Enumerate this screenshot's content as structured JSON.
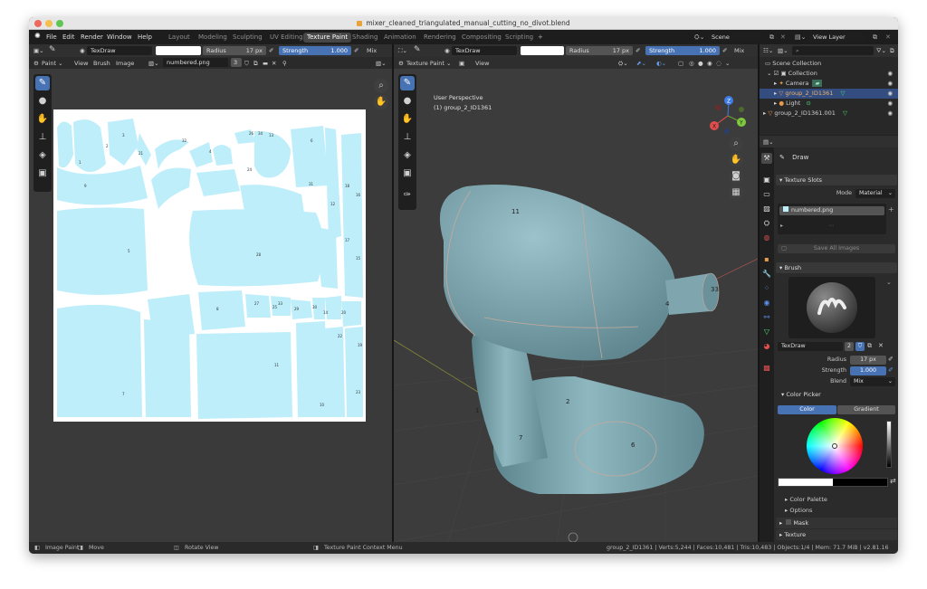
{
  "window": {
    "title": "mixer_cleaned_triangulated_manual_cutting_no_divot.blend"
  },
  "topbar": {
    "menus": [
      "File",
      "Edit",
      "Render",
      "Window",
      "Help"
    ],
    "workspaces": [
      "Layout",
      "Modeling",
      "Sculpting",
      "UV Editing",
      "Texture Paint",
      "Shading",
      "Animation",
      "Rendering",
      "Compositing",
      "Scripting"
    ],
    "active_workspace": "Texture Paint",
    "add_tab": "+",
    "scene": "Scene",
    "view_layer": "View Layer"
  },
  "image_editor": {
    "brush_name": "TexDraw",
    "radius_label": "Radius",
    "radius_value": "17 px",
    "strength_label": "Strength",
    "strength_value": "1.000",
    "blend": "Mix",
    "mode": "Paint",
    "menus": [
      "View",
      "Brush",
      "Image"
    ],
    "image_name": "numbered.png",
    "users": "3",
    "uv_labels": [
      "1",
      "2",
      "3",
      "21",
      "32",
      "4",
      "26",
      "34",
      "13",
      "6",
      "24",
      "9",
      "31",
      "5",
      "18",
      "16",
      "12",
      "17",
      "15",
      "27",
      "25",
      "29",
      "30",
      "19",
      "20",
      "23",
      "22",
      "11",
      "14",
      "8",
      "7",
      "28",
      "10",
      "33",
      "26"
    ]
  },
  "viewport": {
    "brush_name": "TexDraw",
    "radius_label": "Radius",
    "radius_value": "17 px",
    "strength_label": "Strength",
    "strength_value": "1.000",
    "blend": "Mix",
    "mode": "Texture Paint",
    "menu_view": "View",
    "overlay_title": "User Perspective",
    "overlay_object": "(1) group_2_ID1361",
    "mesh_labels": [
      "11",
      "4",
      "33",
      "2",
      "1",
      "6",
      "7"
    ],
    "gizmo": {
      "x": "X",
      "y": "Y",
      "z": "Z"
    }
  },
  "outliner": {
    "search_placeholder": "",
    "rows": [
      {
        "label": "Scene Collection"
      },
      {
        "label": "Collection"
      },
      {
        "label": "Camera"
      },
      {
        "label": "group_2_ID1361"
      },
      {
        "label": "Light"
      },
      {
        "label": "group_2_ID1361.001"
      }
    ]
  },
  "properties": {
    "tool_name": "Draw",
    "texture_slots": {
      "header": "Texture Slots",
      "mode_label": "Mode",
      "mode_value": "Material",
      "slot": "numbered.png",
      "save_all": "Save All Images"
    },
    "brush": {
      "header": "Brush",
      "name": "TexDraw",
      "users": "2",
      "radius_label": "Radius",
      "radius_value": "17 px",
      "strength_label": "Strength",
      "strength_value": "1.000",
      "blend_label": "Blend",
      "blend_value": "Mix"
    },
    "color_picker": {
      "header": "Color Picker",
      "tab_color": "Color",
      "tab_gradient": "Gradient"
    },
    "collapsed": [
      "Color Palette",
      "Options",
      "Mask",
      "Texture"
    ]
  },
  "status": {
    "image_paint": "Image Paint",
    "move": "Move",
    "rotate": "Rotate View",
    "context_menu": "Texture Paint Context Menu",
    "stats": "group_2_ID1361 | Verts:5,244 | Faces:10,481 | Tris:10,483 | Objects:1/4 | Mem: 71.7 MiB | v2.81.16"
  },
  "colors": {
    "accent": "#4772b3",
    "uv_fill": "#bdeefa",
    "mesh": "#7fa5ae"
  }
}
